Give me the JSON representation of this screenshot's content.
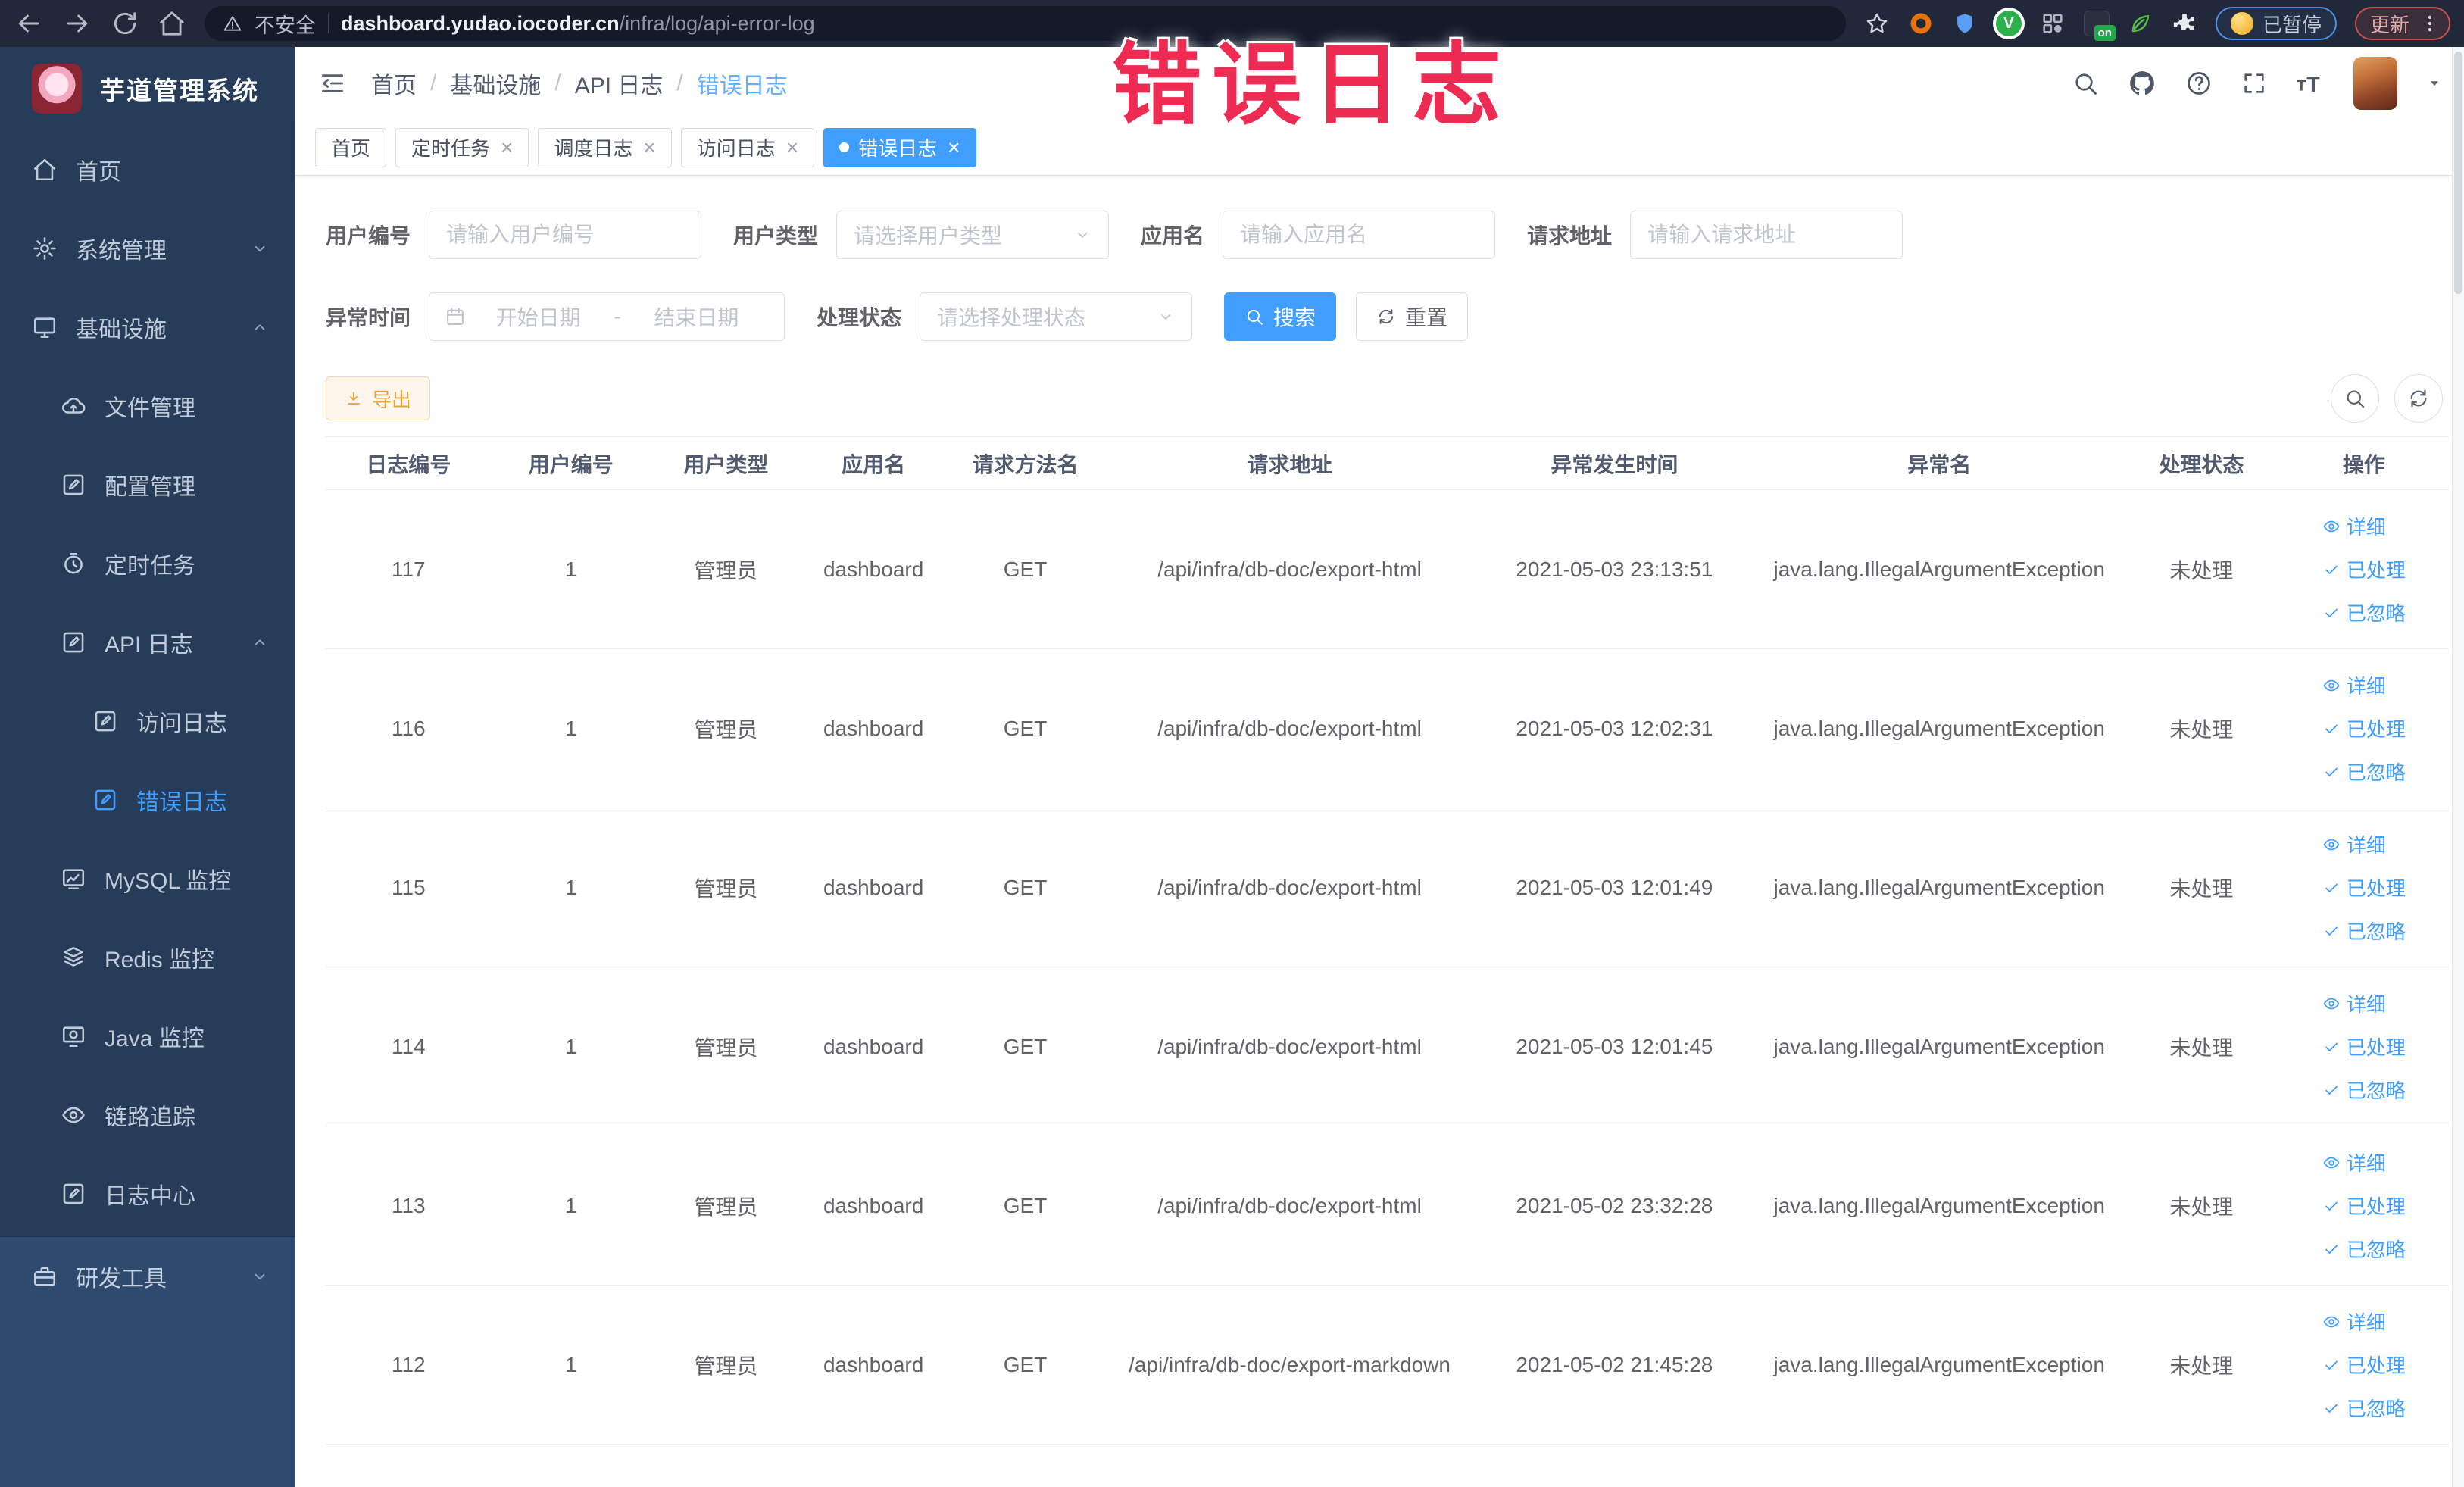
{
  "browser": {
    "security_label": "不安全",
    "url_host": "dashboard.yudao.iocoder.cn",
    "url_path": "/infra/log/api-error-log",
    "extension_badge": "on",
    "paused_pill": "已暂停",
    "update_pill": "更新"
  },
  "annotation": {
    "text": "错误日志"
  },
  "colors": {
    "accent": "#409eff",
    "export_orange": "#e6a23c",
    "annotation_red": "#ee2b52",
    "sidebar_dark": "#263c59",
    "sidebar_light": "#2e4a6e",
    "chrome_dark": "#202839"
  },
  "sidebar": {
    "logo_title": "芋道管理系统",
    "items": [
      {
        "name": "home",
        "icon": "home",
        "label": "首页",
        "level": 1
      },
      {
        "name": "system",
        "icon": "gear",
        "label": "系统管理",
        "level": 1,
        "arrow": "down"
      },
      {
        "name": "infra",
        "icon": "monitor",
        "label": "基础设施",
        "level": 1,
        "arrow": "up"
      },
      {
        "name": "file",
        "icon": "cloud",
        "label": "文件管理",
        "level": 2
      },
      {
        "name": "config",
        "icon": "edit",
        "label": "配置管理",
        "level": 2
      },
      {
        "name": "job",
        "icon": "timer",
        "label": "定时任务",
        "level": 2
      },
      {
        "name": "api-log",
        "icon": "doc",
        "label": "API 日志",
        "level": 2,
        "arrow": "up"
      },
      {
        "name": "access-log",
        "icon": "doc",
        "label": "访问日志",
        "level": 3
      },
      {
        "name": "error-log",
        "icon": "doc",
        "label": "错误日志",
        "level": 3,
        "active": true
      },
      {
        "name": "mysql",
        "icon": "chart",
        "label": "MySQL 监控",
        "level": 2
      },
      {
        "name": "redis",
        "icon": "stack",
        "label": "Redis 监控",
        "level": 2
      },
      {
        "name": "java",
        "icon": "screen",
        "label": "Java 监控",
        "level": 2
      },
      {
        "name": "trace",
        "icon": "eye",
        "label": "链路追踪",
        "level": 2
      },
      {
        "name": "log-center",
        "icon": "doc",
        "label": "日志中心",
        "level": 2
      },
      {
        "name": "dev-tools",
        "icon": "briefcase",
        "label": "研发工具",
        "level": 1,
        "arrow": "down",
        "section": "light"
      }
    ]
  },
  "topbar": {
    "breadcrumb": [
      "首页",
      "基础设施",
      "API 日志",
      "错误日志"
    ]
  },
  "tabs": [
    {
      "label": "首页",
      "closable": false,
      "active": false
    },
    {
      "label": "定时任务",
      "closable": true,
      "active": false
    },
    {
      "label": "调度日志",
      "closable": true,
      "active": false
    },
    {
      "label": "访问日志",
      "closable": true,
      "active": false
    },
    {
      "label": "错误日志",
      "closable": true,
      "active": true
    }
  ],
  "filters": {
    "row1": [
      {
        "key": "user-id",
        "label": "用户编号",
        "type": "input",
        "placeholder": "请输入用户编号"
      },
      {
        "key": "user-type",
        "label": "用户类型",
        "type": "select",
        "placeholder": "请选择用户类型"
      },
      {
        "key": "app-name",
        "label": "应用名",
        "type": "input",
        "placeholder": "请输入应用名"
      },
      {
        "key": "req-url",
        "label": "请求地址",
        "type": "input",
        "placeholder": "请输入请求地址"
      }
    ],
    "row2_label": "异常时间",
    "date_start_placeholder": "开始日期",
    "date_separator": "-",
    "date_end_placeholder": "结束日期",
    "status_label": "处理状态",
    "status_placeholder": "请选择处理状态",
    "search_button": "搜索",
    "reset_button": "重置"
  },
  "toolbar": {
    "export_button": "导出"
  },
  "table": {
    "columns": [
      "日志编号",
      "用户编号",
      "用户类型",
      "应用名",
      "请求方法名",
      "请求地址",
      "异常发生时间",
      "异常名",
      "处理状态",
      "操作"
    ],
    "column_keys": [
      "log-id",
      "user-id",
      "user-type",
      "app-name",
      "method-name",
      "request-url",
      "error-time",
      "exception-name",
      "status",
      "actions"
    ],
    "row_actions": [
      "详细",
      "已处理",
      "已忽略"
    ],
    "rows": [
      [
        "117",
        "1",
        "管理员",
        "dashboard",
        "GET",
        "/api/infra/db-doc/export-html",
        "2021-05-03 23:13:51",
        "java.lang.IllegalArgumentException",
        "未处理"
      ],
      [
        "116",
        "1",
        "管理员",
        "dashboard",
        "GET",
        "/api/infra/db-doc/export-html",
        "2021-05-03 12:02:31",
        "java.lang.IllegalArgumentException",
        "未处理"
      ],
      [
        "115",
        "1",
        "管理员",
        "dashboard",
        "GET",
        "/api/infra/db-doc/export-html",
        "2021-05-03 12:01:49",
        "java.lang.IllegalArgumentException",
        "未处理"
      ],
      [
        "114",
        "1",
        "管理员",
        "dashboard",
        "GET",
        "/api/infra/db-doc/export-html",
        "2021-05-03 12:01:45",
        "java.lang.IllegalArgumentException",
        "未处理"
      ],
      [
        "113",
        "1",
        "管理员",
        "dashboard",
        "GET",
        "/api/infra/db-doc/export-html",
        "2021-05-02 23:32:28",
        "java.lang.IllegalArgumentException",
        "未处理"
      ],
      [
        "112",
        "1",
        "管理员",
        "dashboard",
        "GET",
        "/api/infra/db-doc/export-markdown",
        "2021-05-02 21:45:28",
        "java.lang.IllegalArgumentException",
        "未处理"
      ]
    ]
  }
}
